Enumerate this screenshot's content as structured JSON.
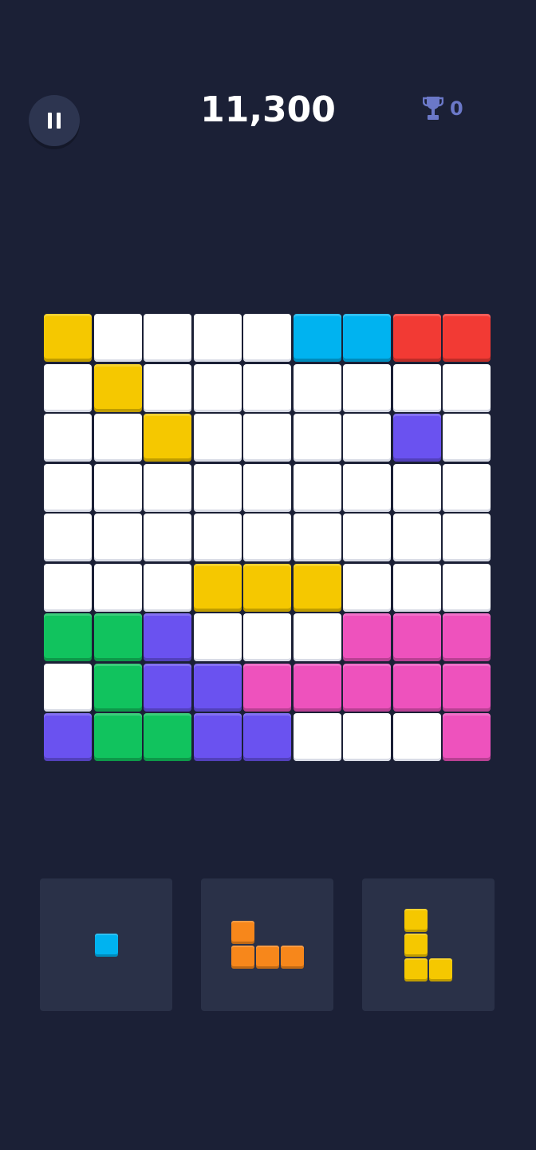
{
  "header": {
    "score": "11,300",
    "best_score": "0",
    "pause_icon": "pause-icon",
    "trophy_icon": "trophy-icon"
  },
  "colors": {
    "Y": "#f5c800",
    "B": "#00b3f0",
    "R": "#f23a34",
    "P": "#6a52f0",
    "G": "#11c35e",
    "K": "#ee52bd",
    "O": "#f7871b",
    "empty": "#ffffff",
    "background": "#1b2036",
    "tray": "#2a3148"
  },
  "board": [
    [
      "Y",
      ".",
      ".",
      ".",
      ".",
      "B",
      "B",
      "R",
      "R"
    ],
    [
      ".",
      "Y",
      ".",
      ".",
      ".",
      ".",
      ".",
      ".",
      "."
    ],
    [
      ".",
      ".",
      "Y",
      ".",
      ".",
      ".",
      ".",
      "P",
      "."
    ],
    [
      ".",
      ".",
      ".",
      ".",
      ".",
      ".",
      ".",
      ".",
      "."
    ],
    [
      ".",
      ".",
      ".",
      ".",
      ".",
      ".",
      ".",
      ".",
      "."
    ],
    [
      ".",
      ".",
      ".",
      "Y",
      "Y",
      "Y",
      ".",
      ".",
      "."
    ],
    [
      "G",
      "G",
      "P",
      ".",
      ".",
      ".",
      "K",
      "K",
      "K"
    ],
    [
      ".",
      "G",
      "P",
      "P",
      "K",
      "K",
      "K",
      "K",
      "K"
    ],
    [
      "P",
      "G",
      "G",
      "P",
      "P",
      ".",
      ".",
      ".",
      "K"
    ]
  ],
  "pieces": [
    {
      "color": "B",
      "cells": [
        [
          0,
          0
        ]
      ]
    },
    {
      "color": "O",
      "cells": [
        [
          0,
          0
        ],
        [
          1,
          0
        ],
        [
          1,
          1
        ],
        [
          1,
          2
        ]
      ]
    },
    {
      "color": "Y",
      "cells": [
        [
          0,
          0
        ],
        [
          1,
          0
        ],
        [
          2,
          0
        ],
        [
          2,
          1
        ]
      ]
    }
  ]
}
